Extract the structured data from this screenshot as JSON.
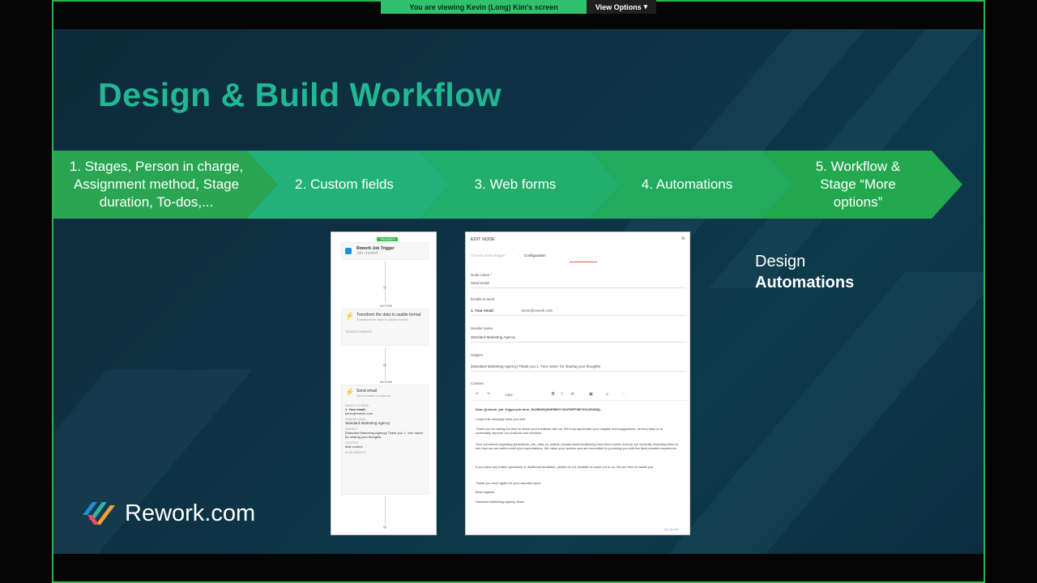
{
  "share_bar": {
    "viewing_text": "You are viewing  Kevin (Long) Kim's screen",
    "view_options": "View Options"
  },
  "slide": {
    "title": "Design & Build Workflow",
    "steps": [
      {
        "lines": [
          "1. Stages, Person in charge,",
          "Assignment method, Stage",
          "duration, To-dos,..."
        ]
      },
      {
        "lines": [
          "2. Custom fields"
        ]
      },
      {
        "lines": [
          "3. Web forms"
        ]
      },
      {
        "lines": [
          "4. Automations"
        ]
      },
      {
        "lines": [
          "5. Workflow &",
          "Stage “More",
          "options”"
        ]
      }
    ],
    "design_label": {
      "line1": "Design",
      "line2": "Automations"
    },
    "logo_text": "Rework.com"
  },
  "workflow_panel": {
    "trigger_tag": "TRIGGER",
    "trigger_title": "Rework Job Trigger",
    "trigger_sub": "Job created",
    "action_tag_1": "ACTION",
    "action1_title": "Transform the data to usable format",
    "action1_sub": "Transform the data to usable format",
    "action1_meta": "TRANSFORMERS",
    "action_tag_2": "ACTION",
    "action2_title": "Send email",
    "action2_sub": "Send emails to external",
    "emails_label": "EMAILS TO SEND",
    "emails_value": "1. Your email:",
    "emails_value2": "kevin@rework.com",
    "sender_label": "SENDER NAME",
    "sender_value": "Standard Marketing Agency",
    "subject_label": "SUBJECT",
    "subject_value": "[Standard Marketing Agency] Thank you   1. Your name:        for sharing your thoughts",
    "content_label": "CONTENT",
    "content_value": "Mail content",
    "attachments_label": "ATTACHMENTS"
  },
  "edit_node": {
    "header": "EDIT NODE",
    "crumb_1": "Choose action/trigger",
    "crumb_2": "Configuration",
    "node_name_label": "Node name *",
    "node_name_value": "Send email",
    "emails_label": "Emails to send",
    "emails_value": "1. Your email:",
    "emails_value_extra": ", kevin@rework.com",
    "sender_label": "Sender name",
    "sender_value": "Standard Marketing Agency",
    "subject_label": "Subject",
    "subject_value": "[Standard Marketing Agency] Thank you   1. Your name:        for sharing your thoughts",
    "content_label": "Content",
    "font_size": "14px",
    "body": [
      "Dear  {{rework_job_trigger.job.form_HU3BUEQ9HE9BGY43ATMPF8B73S2APAM}},",
      "I hope this message finds you well.",
      "Thank you for taking the time to share your feedback with us. We truly appreciate your insights and suggestions, as they help us to continually improve our products and services.",
      "Your comments regarding  {{transform_the_data_to_usable_format.result.feedback}}  have been noted, and we are currently reviewing them to see how we can better meet your expectations. We value your opinion and are committed to providing you with the best possible experience.",
      "If you have any further questions or additional feedback, please do not hesitate to reach out to us. We are here to assist you.",
      "Thank you once again for your valuable input.",
      "Best regards,",
      "Standard Marketing Agency Team"
    ],
    "word_count": "114 words"
  }
}
